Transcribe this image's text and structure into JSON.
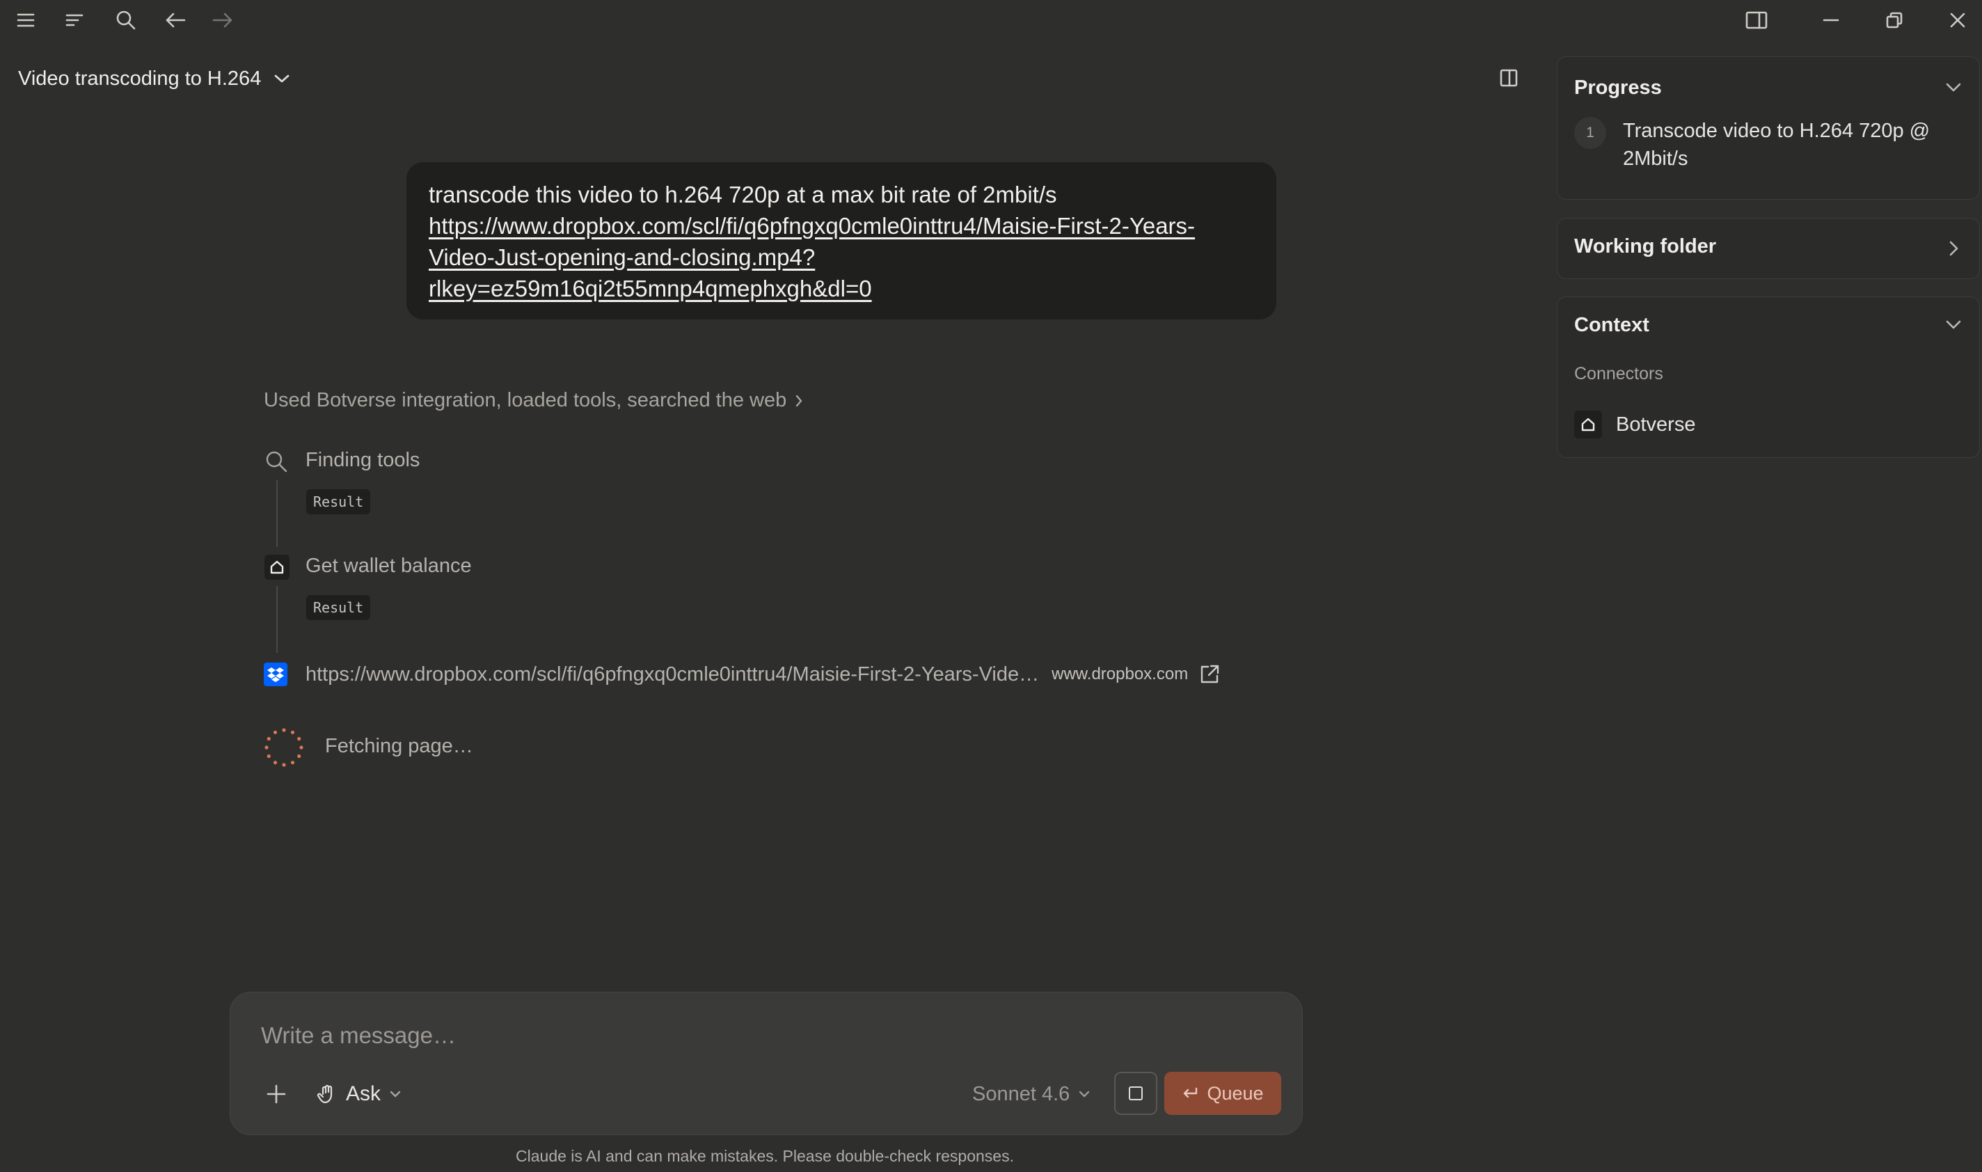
{
  "conversation": {
    "title": "Video transcoding to H.264"
  },
  "user_message": {
    "line1": "transcode this video to h.264 720p at a max bit rate of 2mbit/s",
    "link_line1": "https://www.dropbox.com/scl/fi/q6pfngxq0cmle0inttru4/Maisie-First-2-Years-",
    "link_line2": "Video-Just-opening-and-closing.mp4?",
    "link_line3": "rlkey=ez59m16qi2t55mnp4qmephxgh&dl=0"
  },
  "activity": {
    "summary": "Used Botverse integration, loaded tools, searched the web",
    "steps": [
      {
        "title": "Finding tools",
        "chip": "Result"
      },
      {
        "title": "Get wallet balance",
        "chip": "Result"
      }
    ],
    "link": {
      "url": "https://www.dropbox.com/scl/fi/q6pfngxq0cmle0inttru4/Maisie-First-2-Years-Vide…",
      "domain": "www.dropbox.com"
    },
    "status": "Fetching page…"
  },
  "composer": {
    "placeholder": "Write a message…",
    "mode_label": "Ask",
    "model_label": "Sonnet 4.6",
    "queue_label": "Queue",
    "disclaimer": "Claude is AI and can make mistakes. Please double-check responses."
  },
  "panel": {
    "progress": {
      "title": "Progress",
      "items": [
        {
          "number": "1",
          "line1": "Transcode video to H.264 720p @",
          "line2": "2Mbit/s"
        }
      ]
    },
    "working_folder": {
      "title": "Working folder"
    },
    "context": {
      "title": "Context",
      "section_label": "Connectors",
      "connectors": [
        {
          "name": "Botverse"
        }
      ]
    }
  },
  "colors": {
    "background": "#2e2e2d",
    "accent": "#8c4a35",
    "spinner": "#d97757",
    "dropbox": "#0061fe"
  }
}
